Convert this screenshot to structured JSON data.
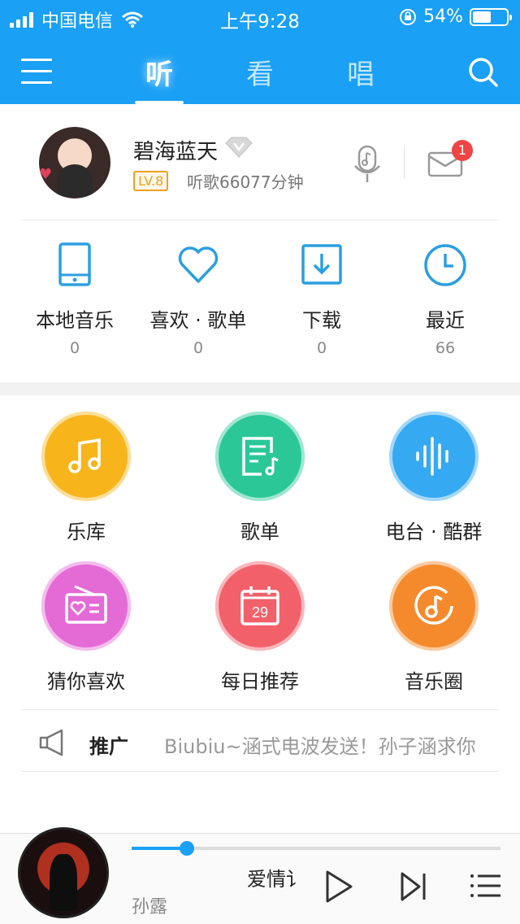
{
  "status_bar": {
    "carrier": "中国电信",
    "time": "上午9:28",
    "battery_percent_text": "54%",
    "battery_level": 0.54
  },
  "nav": {
    "tabs": [
      {
        "label": "听",
        "active": true
      },
      {
        "label": "看",
        "active": false
      },
      {
        "label": "唱",
        "active": false
      }
    ]
  },
  "profile": {
    "name": "碧海蓝天",
    "level": "LV.8",
    "listen_time": "听歌66077分钟",
    "mail_badge": "1"
  },
  "quick_access": [
    {
      "label": "本地音乐",
      "count": "0",
      "icon": "tablet-icon"
    },
    {
      "label": "喜欢 · 歌单",
      "count": "0",
      "icon": "heart-icon"
    },
    {
      "label": "下载",
      "count": "0",
      "icon": "download-icon"
    },
    {
      "label": "最近",
      "count": "66",
      "icon": "clock-icon"
    }
  ],
  "features": [
    {
      "label": "乐库",
      "icon": "music-note-icon",
      "color": "#f7b51b"
    },
    {
      "label": "歌单",
      "icon": "playlist-icon",
      "color": "#2bc797"
    },
    {
      "label": "电台 · 酷群",
      "icon": "soundwave-icon",
      "color": "#35a9f2"
    },
    {
      "label": "猜你喜欢",
      "icon": "radio-icon",
      "color": "#e46ad6"
    },
    {
      "label": "每日推荐",
      "icon": "calendar-icon",
      "color": "#f2606a"
    },
    {
      "label": "音乐圈",
      "icon": "music-circle-icon",
      "color": "#f58a2c"
    }
  ],
  "promo": {
    "label": "推广",
    "text": "Biubiu~涵式电波发送！孙子涵求你"
  },
  "player": {
    "song": "爱情讠",
    "artist": "孙露",
    "progress": 0.15
  },
  "colors": {
    "brand": "#1aa0f5",
    "icon_blue": "#2b9fe0"
  }
}
